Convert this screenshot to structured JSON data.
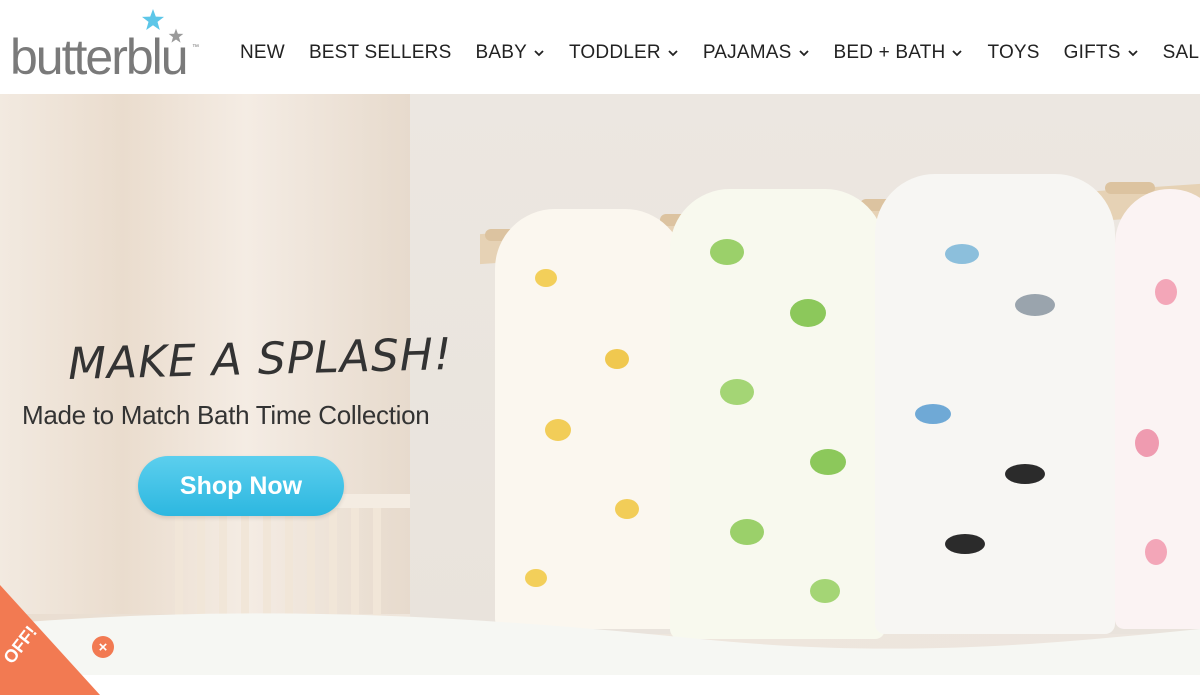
{
  "brand": {
    "logo_text": "butterblu",
    "logo_tm": "™"
  },
  "nav": {
    "items": [
      {
        "label": "NEW"
      },
      {
        "label": "BEST SELLERS"
      },
      {
        "label": "BABY"
      },
      {
        "label": "TODDLER"
      },
      {
        "label": "PAJAMAS"
      },
      {
        "label": "BED + BATH"
      },
      {
        "label": "TOYS"
      },
      {
        "label": "GIFTS"
      },
      {
        "label": "SALE"
      }
    ]
  },
  "hero": {
    "headline": "MAKE A SPLASH!",
    "subline": "Made to Match Bath Time Collection",
    "cta_label": "Shop Now"
  },
  "promo": {
    "text": "OFF!",
    "close_symbol": "×"
  },
  "colors": {
    "accent": "#2cb7e0",
    "promo": "#f27a52",
    "nav_text": "#222222",
    "logo_gray": "#7a7a7a",
    "star_blue": "#5cc6e8"
  }
}
